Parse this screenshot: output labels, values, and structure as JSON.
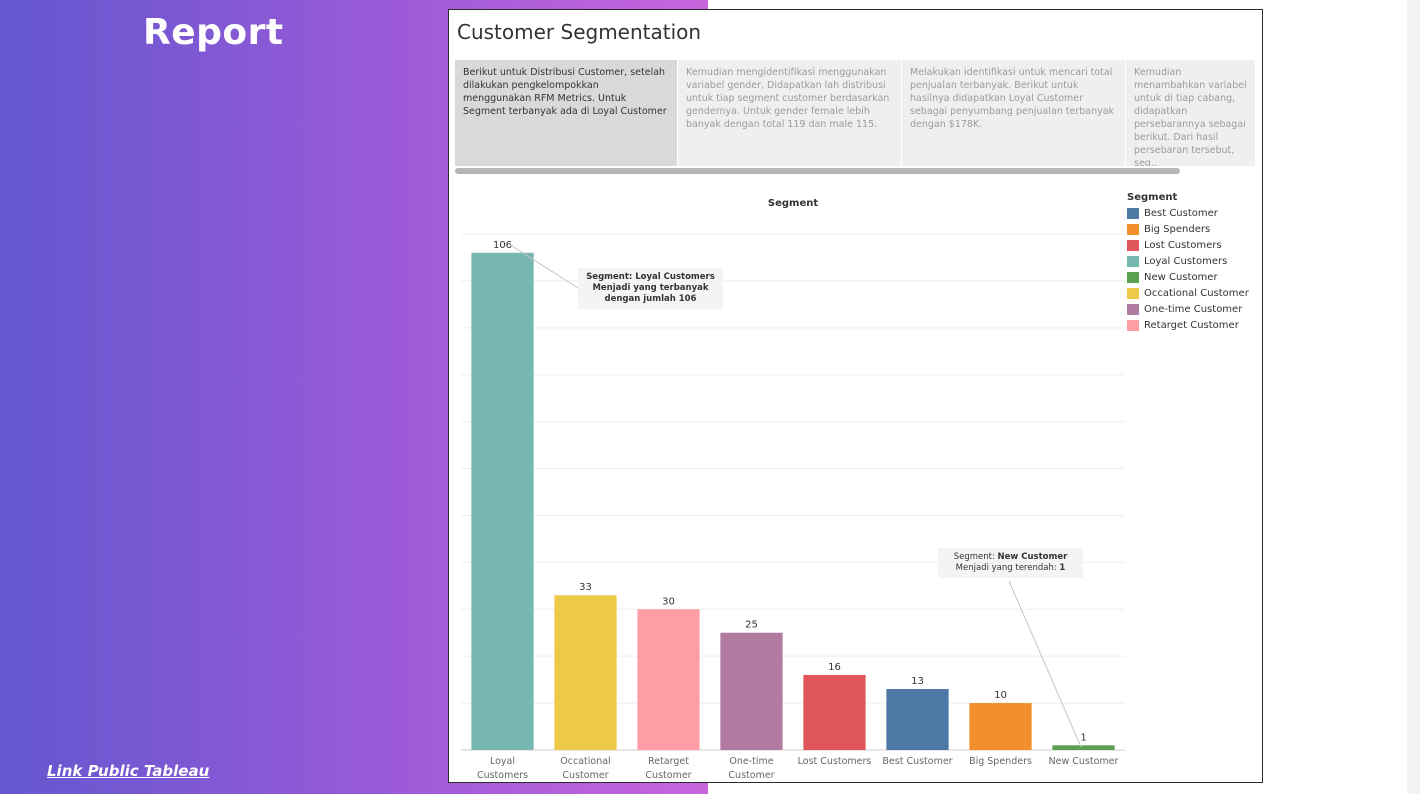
{
  "report_title": "Report",
  "link_text": "Link Public Tableau",
  "dashboard_title": "Customer Segmentation",
  "story_points": [
    "Berikut untuk Distribusi Customer, setelah dilakukan pengkelompokkan menggunakan RFM Metrics. Untuk Segment terbanyak ada di Loyal Customer",
    "Kemudian mengidentifikasi menggunakan variabel gender, Didapatkan lah distribusi untuk tiap segment customer berdasarkan gendernya. Untuk gender female lebih banyak dengan total 119 dan male 115.",
    "Melakukan identifikasi untuk mencari total penjualan terbanyak. Berikut untuk hasilnya didapatkan Loyal Customer sebagai penyumbang penjualan terbanyak dengan $178K.",
    "Kemudian menambahkan variabel untuk di tiap cabang, didapatkan persebarannya sebagai berikut. Dari hasil persebaran tersebut, seg.."
  ],
  "chart_data": {
    "type": "bar",
    "title": "Segment",
    "categories": [
      "Loyal Customers",
      "Occational Customer",
      "Retarget Customer",
      "One-time Customer",
      "Lost Customers",
      "Best Customer",
      "Big Spenders",
      "New Customer"
    ],
    "values": [
      106,
      33,
      30,
      25,
      16,
      13,
      10,
      1
    ],
    "colors": [
      "#76b7b2",
      "#edc948",
      "#ff9da7",
      "#b07aa1",
      "#e15759",
      "#4e79a7",
      "#f28e2b",
      "#59a14f"
    ],
    "ylim": [
      0,
      110
    ],
    "grid": true,
    "legend_title": "Segment",
    "legend": [
      {
        "label": "Best Customer",
        "color": "#4e79a7"
      },
      {
        "label": "Big Spenders",
        "color": "#f28e2b"
      },
      {
        "label": "Lost Customers",
        "color": "#e15759"
      },
      {
        "label": "Loyal Customers",
        "color": "#76b7b2"
      },
      {
        "label": "New Customer",
        "color": "#59a14f"
      },
      {
        "label": "Occational Customer",
        "color": "#edc948"
      },
      {
        "label": "One-time Customer",
        "color": "#b07aa1"
      },
      {
        "label": "Retarget Customer",
        "color": "#ff9da7"
      }
    ],
    "annotations": [
      {
        "lines": [
          "Segment: Loyal Customers",
          "Menjadi yang terbanyak",
          "dengan jumlah 106"
        ]
      },
      {
        "line1_prefix": "Segment: ",
        "line1_value": "New Customer",
        "line2_prefix": "Menjadi yang terendah: ",
        "line2_value": "1"
      }
    ]
  }
}
